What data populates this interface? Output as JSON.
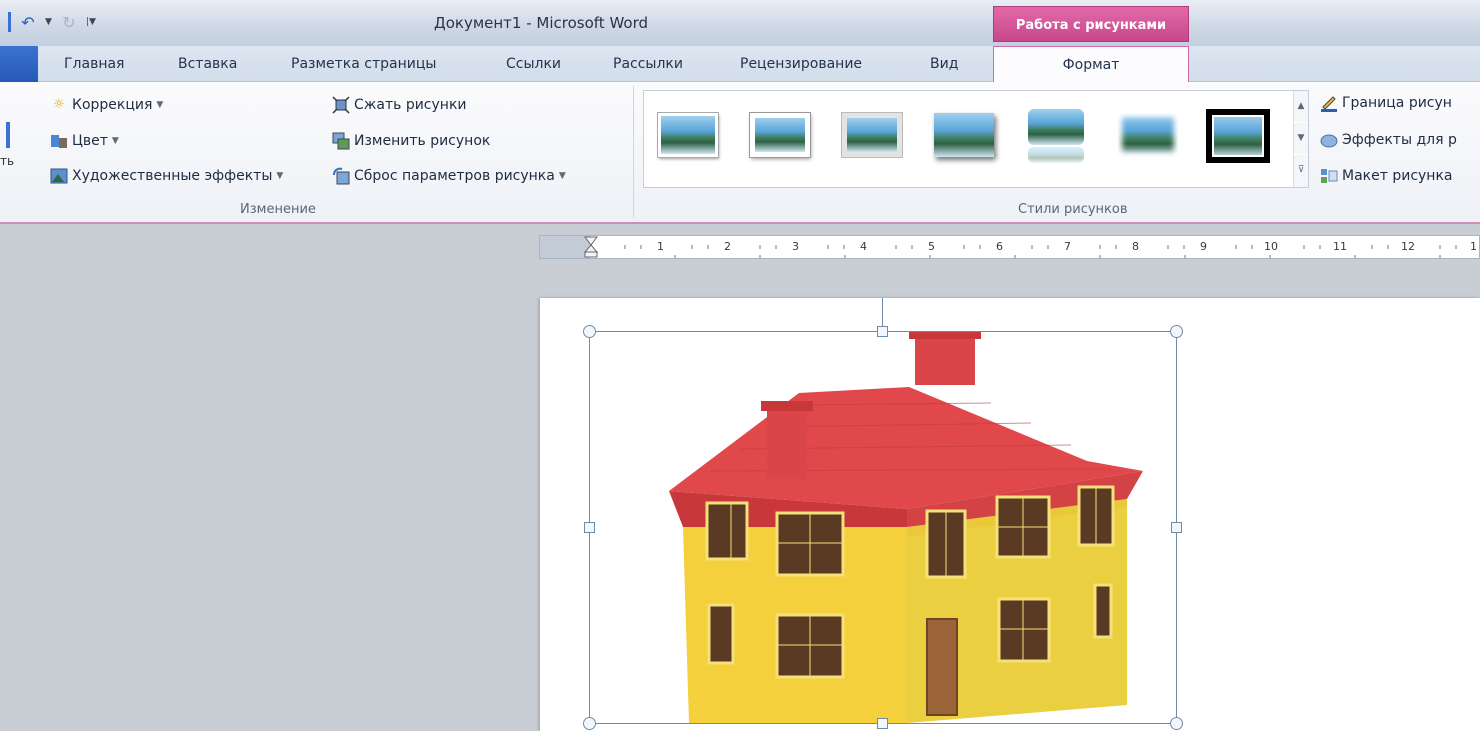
{
  "title_bar": {
    "title": "Документ1 - Microsoft Word",
    "context_header": "Работа с рисунками"
  },
  "qat": {
    "undo_icon": "undo-icon",
    "redo_icon": "redo-icon",
    "customize_icon": "customize-qat-icon"
  },
  "tabs": [
    {
      "label": "Главная"
    },
    {
      "label": "Вставка"
    },
    {
      "label": "Разметка страницы"
    },
    {
      "label": "Ссылки"
    },
    {
      "label": "Рассылки"
    },
    {
      "label": "Рецензирование"
    },
    {
      "label": "Вид"
    }
  ],
  "context_tab": {
    "label": "Формат"
  },
  "ribbon": {
    "left_stub_text": "ть",
    "adjust_group": {
      "label": "Изменение",
      "corrections": "Коррекция",
      "color": "Цвет",
      "artistic_effects": "Художественные эффекты",
      "compress": "Сжать рисунки",
      "change_picture": "Изменить рисунок",
      "reset_picture": "Сброс параметров рисунка"
    },
    "styles_group": {
      "label": "Стили рисунков",
      "border": "Граница рисун",
      "effects": "Эффекты для р",
      "layout": "Макет рисунка"
    }
  },
  "ruler": {
    "numbers": [
      "1",
      "2",
      "3",
      "4",
      "5",
      "6",
      "7",
      "8",
      "9",
      "10",
      "11",
      "12",
      "1"
    ]
  },
  "colors": {
    "context_accent": "#d0478f",
    "roof": "#e0484b",
    "walls": "#f3d03c",
    "windows": "#5a3a22"
  }
}
